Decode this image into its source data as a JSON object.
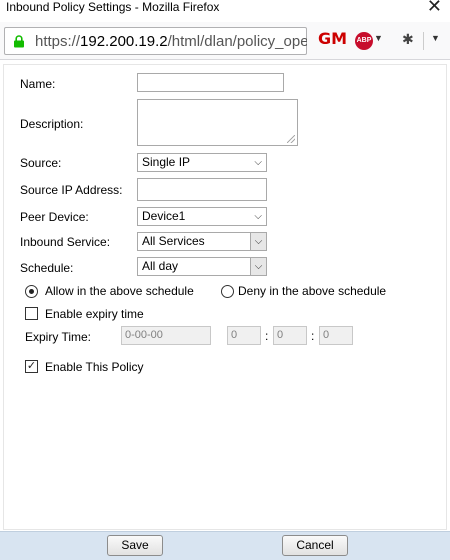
{
  "window": {
    "title": "Inbound Policy Settings - Mozilla Firefox",
    "close_glyph": "✕"
  },
  "browser": {
    "url_prefix": "https://",
    "url_host": "192.200.19.2",
    "url_path": "/html/dlan/policy_oper"
  },
  "form": {
    "name": {
      "label": "Name:",
      "value": ""
    },
    "description": {
      "label": "Description:",
      "value": ""
    },
    "source": {
      "label": "Source:",
      "value": "Single IP"
    },
    "source_ip": {
      "label": "Source IP Address:",
      "value": ""
    },
    "peer_device": {
      "label": "Peer Device:",
      "value": "Device1"
    },
    "inbound_service": {
      "label": "Inbound Service:",
      "value": "All Services"
    },
    "schedule": {
      "label": "Schedule:",
      "value": "All day"
    },
    "schedule_mode": {
      "allow_label": "Allow in the above schedule",
      "deny_label": "Deny in the above schedule",
      "selected": "allow"
    },
    "enable_expiry": {
      "label": "Enable expiry time",
      "checked": false
    },
    "expiry_time": {
      "label": "Expiry Time:",
      "date": "0-00-00",
      "hour": "0",
      "minute": "0",
      "second": "0",
      "sep": ":"
    },
    "enable_policy": {
      "label": "Enable This Policy",
      "checked": true
    }
  },
  "footer": {
    "save_label": "Save",
    "cancel_label": "Cancel"
  },
  "icons": {
    "lock": "lock-icon",
    "gm": "greasemonkey-icon",
    "abp": "adblock-icon",
    "bug": "bug-icon",
    "menu": "chevron-down-icon"
  },
  "extensions": {
    "gm_text": "GM",
    "abp_text": "ABP"
  }
}
